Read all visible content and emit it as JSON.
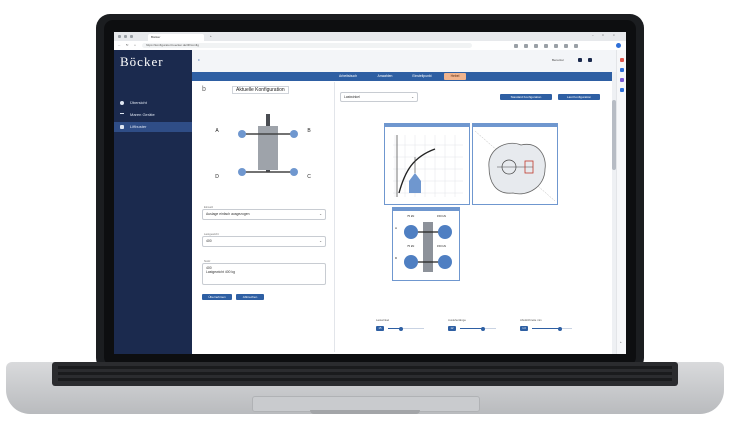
{
  "browser": {
    "tab_title": "Böcker",
    "url": "https://konfigurator.boecker.de/lift/config",
    "new_tab_label": "+"
  },
  "app": {
    "logo": "Böcker",
    "user": "Benutzer",
    "sidebar": {
      "items": [
        {
          "label": "Übersicht",
          "icon": "dashboard-icon"
        },
        {
          "label": "Maren Geräte",
          "icon": "wifi-icon"
        },
        {
          "label": "Liftbuster",
          "icon": "wrench-icon"
        }
      ],
      "active_index": 2
    },
    "tabs": [
      "Arbeitsbuch",
      "Anwahlen",
      "Einstellpunkt",
      "Hebel"
    ],
    "active_tab": 3,
    "left_panel": {
      "title": "Aktuelle Konfiguration",
      "positions": [
        "A",
        "B",
        "C",
        "D"
      ],
      "select1_label": "Einsatz",
      "select1_value": "Auslage einfach ausgezogen",
      "select2_label": "Lastgewicht",
      "select2_value": "400",
      "textarea_label": "Notiz",
      "textarea_line1": "400",
      "textarea_line2": "Lastgewicht 400 kg",
      "button1": "Übernehmen",
      "button2": "Abbrechen"
    },
    "right_panel": {
      "select_value": "Lastwinkel",
      "button1": "Standard Konfiguration",
      "button2": "Last Konfiguration"
    },
    "diagram_labels": {
      "top_left": "75 kN",
      "top_right": "150 kN",
      "bottom_left": "75 kN",
      "bottom_right": "150 kN"
    },
    "sliders": [
      {
        "label": "Lastwinkel",
        "value": "15",
        "fill": 0.35
      },
      {
        "label": "Ausleherlänge",
        "value": "12",
        "fill": 0.65
      },
      {
        "label": "Abstützbreite min",
        "value": "1.0",
        "fill": 0.7
      }
    ]
  },
  "colors": {
    "sidebar": "#1b2a4e",
    "tabs": "#2e5fa3",
    "active_tab": "#f1b48d",
    "accent": "#2e5fa3",
    "outrigger": "#6f97cf"
  }
}
